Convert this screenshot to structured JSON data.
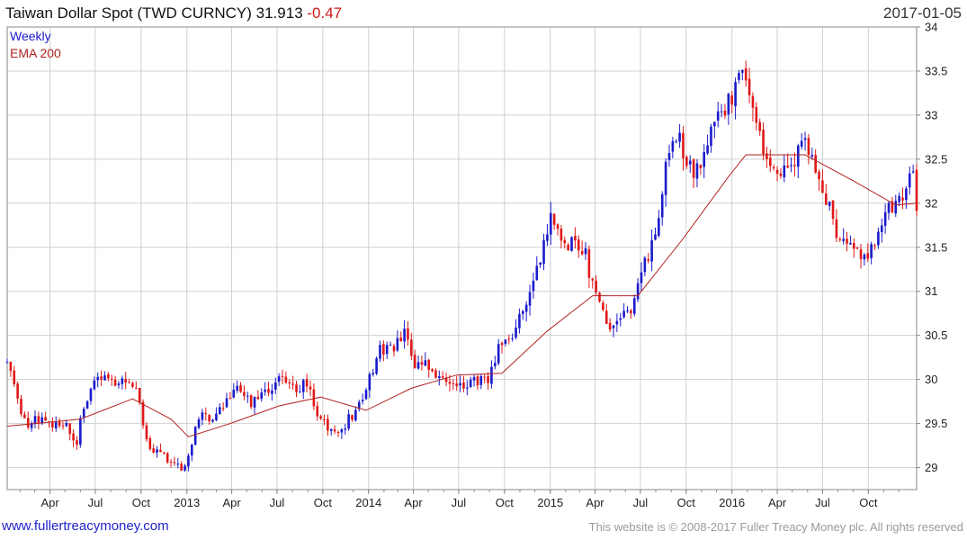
{
  "header": {
    "title_main": "Taiwan Dollar Spot (TWD CURNCY) 31.913",
    "title_change": "-0.47",
    "date": "2017-01-05"
  },
  "legend": {
    "period": "Weekly",
    "ema": "EMA 200"
  },
  "footer": {
    "site": "www.fullertreacymoney.com",
    "copyright": "This website is © 2008-2017 Fuller Treacy Money plc. All rights reserved"
  },
  "colors": {
    "up": "#1a1acc",
    "down": "#e01818",
    "ema": "#b22222",
    "grid": "#d0d0d0",
    "frame": "#888888"
  },
  "chart_data": {
    "type": "candlestick",
    "interval": "weekly",
    "x_range": [
      "2012-01-06",
      "2017-01-06"
    ],
    "ylim": [
      28.75,
      34
    ],
    "y_ticks": [
      29,
      29.5,
      30,
      30.5,
      31,
      31.5,
      32,
      32.5,
      33,
      33.5,
      34
    ],
    "x_ticks": [
      {
        "label": "Apr",
        "date": "2012-04-01"
      },
      {
        "label": "Jul",
        "date": "2012-07-01"
      },
      {
        "label": "Oct",
        "date": "2012-10-01"
      },
      {
        "label": "2013",
        "date": "2013-01-01"
      },
      {
        "label": "Apr",
        "date": "2013-04-01"
      },
      {
        "label": "Jul",
        "date": "2013-07-01"
      },
      {
        "label": "Oct",
        "date": "2013-10-01"
      },
      {
        "label": "2014",
        "date": "2014-01-01"
      },
      {
        "label": "Apr",
        "date": "2014-04-01"
      },
      {
        "label": "Jul",
        "date": "2014-07-01"
      },
      {
        "label": "Oct",
        "date": "2014-10-01"
      },
      {
        "label": "2015",
        "date": "2015-01-01"
      },
      {
        "label": "Apr",
        "date": "2015-04-01"
      },
      {
        "label": "Jul",
        "date": "2015-07-01"
      },
      {
        "label": "Oct",
        "date": "2015-10-01"
      },
      {
        "label": "2016",
        "date": "2016-01-01"
      },
      {
        "label": "Apr",
        "date": "2016-04-01"
      },
      {
        "label": "Jul",
        "date": "2016-07-01"
      },
      {
        "label": "Oct",
        "date": "2016-10-01"
      }
    ],
    "grid": true,
    "close_path": [
      [
        "2012-01-06",
        30.2
      ],
      [
        "2012-01-20",
        29.9
      ],
      [
        "2012-02-10",
        29.5
      ],
      [
        "2012-03-09",
        29.55
      ],
      [
        "2012-04-06",
        29.5
      ],
      [
        "2012-05-04",
        29.45
      ],
      [
        "2012-05-25",
        29.3
      ],
      [
        "2012-06-08",
        29.7
      ],
      [
        "2012-06-29",
        29.95
      ],
      [
        "2012-07-27",
        30.0
      ],
      [
        "2012-08-24",
        29.98
      ],
      [
        "2012-09-21",
        29.9
      ],
      [
        "2012-10-12",
        29.3
      ],
      [
        "2012-11-09",
        29.15
      ],
      [
        "2012-12-07",
        29.05
      ],
      [
        "2012-12-28",
        29.0
      ],
      [
        "2013-01-11",
        29.3
      ],
      [
        "2013-01-25",
        29.55
      ],
      [
        "2013-02-22",
        29.6
      ],
      [
        "2013-03-15",
        29.7
      ],
      [
        "2013-04-05",
        29.9
      ],
      [
        "2013-05-10",
        29.75
      ],
      [
        "2013-05-24",
        29.8
      ],
      [
        "2013-06-21",
        29.9
      ],
      [
        "2013-07-05",
        30.0
      ],
      [
        "2013-08-02",
        29.9
      ],
      [
        "2013-08-30",
        29.95
      ],
      [
        "2013-09-20",
        29.6
      ],
      [
        "2013-10-18",
        29.4
      ],
      [
        "2013-11-15",
        29.5
      ],
      [
        "2013-12-13",
        29.7
      ],
      [
        "2014-01-03",
        30.0
      ],
      [
        "2014-01-24",
        30.35
      ],
      [
        "2014-02-21",
        30.35
      ],
      [
        "2014-03-14",
        30.5
      ],
      [
        "2014-04-04",
        30.2
      ],
      [
        "2014-05-02",
        30.15
      ],
      [
        "2014-06-06",
        29.95
      ],
      [
        "2014-07-04",
        29.95
      ],
      [
        "2014-08-01",
        30.0
      ],
      [
        "2014-08-29",
        29.95
      ],
      [
        "2014-09-19",
        30.4
      ],
      [
        "2014-10-17",
        30.5
      ],
      [
        "2014-11-14",
        30.9
      ],
      [
        "2014-12-12",
        31.4
      ],
      [
        "2015-01-02",
        31.9
      ],
      [
        "2015-01-23",
        31.5
      ],
      [
        "2015-02-20",
        31.6
      ],
      [
        "2015-03-13",
        31.4
      ],
      [
        "2015-04-03",
        30.9
      ],
      [
        "2015-05-01",
        30.6
      ],
      [
        "2015-05-29",
        30.7
      ],
      [
        "2015-06-19",
        30.9
      ],
      [
        "2015-07-10",
        31.3
      ],
      [
        "2015-07-31",
        31.6
      ],
      [
        "2015-08-21",
        32.5
      ],
      [
        "2015-09-18",
        32.7
      ],
      [
        "2015-10-16",
        32.3
      ],
      [
        "2015-11-13",
        32.7
      ],
      [
        "2015-12-11",
        33.0
      ],
      [
        "2016-01-01",
        33.2
      ],
      [
        "2016-01-22",
        33.5
      ],
      [
        "2016-02-12",
        33.2
      ],
      [
        "2016-03-04",
        32.5
      ],
      [
        "2016-04-01",
        32.3
      ],
      [
        "2016-04-29",
        32.4
      ],
      [
        "2016-05-27",
        32.7
      ],
      [
        "2016-06-24",
        32.2
      ],
      [
        "2016-07-15",
        32.0
      ],
      [
        "2016-08-05",
        31.5
      ],
      [
        "2016-08-26",
        31.6
      ],
      [
        "2016-09-16",
        31.3
      ],
      [
        "2016-10-07",
        31.5
      ],
      [
        "2016-10-28",
        31.8
      ],
      [
        "2016-11-18",
        32.0
      ],
      [
        "2016-12-09",
        32.0
      ],
      [
        "2016-12-30",
        32.45
      ],
      [
        "2017-01-06",
        31.913
      ]
    ],
    "ema": {
      "name": "EMA 200",
      "points": [
        [
          "2012-01-06",
          29.47
        ],
        [
          "2012-03-02",
          29.5
        ],
        [
          "2012-06-01",
          29.55
        ],
        [
          "2012-09-14",
          29.78
        ],
        [
          "2012-11-30",
          29.55
        ],
        [
          "2013-01-04",
          29.35
        ],
        [
          "2013-03-29",
          29.5
        ],
        [
          "2013-07-05",
          29.7
        ],
        [
          "2013-09-27",
          29.8
        ],
        [
          "2013-12-27",
          29.65
        ],
        [
          "2014-03-28",
          29.9
        ],
        [
          "2014-06-27",
          30.05
        ],
        [
          "2014-09-26",
          30.07
        ],
        [
          "2014-12-26",
          30.55
        ],
        [
          "2015-03-27",
          30.95
        ],
        [
          "2015-06-26",
          30.95
        ],
        [
          "2015-09-25",
          31.6
        ],
        [
          "2015-12-25",
          32.3
        ],
        [
          "2016-01-29",
          32.55
        ],
        [
          "2016-05-27",
          32.55
        ],
        [
          "2016-09-02",
          32.25
        ],
        [
          "2016-11-25",
          31.98
        ],
        [
          "2017-01-06",
          32.0
        ]
      ]
    },
    "candles": []
  }
}
